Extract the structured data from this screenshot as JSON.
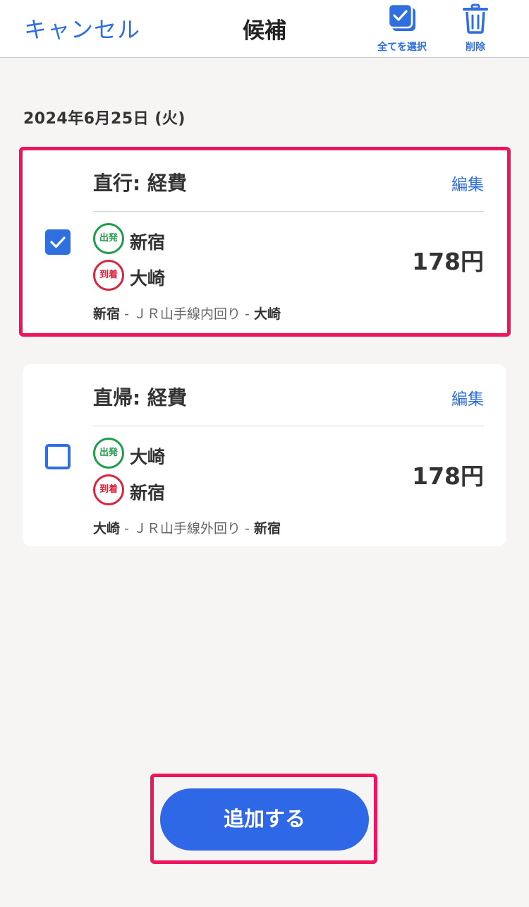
{
  "header": {
    "cancel_label": "キャンセル",
    "title": "候補",
    "select_all_label": "全てを選択",
    "delete_label": "削除"
  },
  "date_label": "2024年6月25日 (火)",
  "candidates": [
    {
      "title": "直行: 経費",
      "edit_label": "編集",
      "checked": true,
      "departure_badge": "出発",
      "arrival_badge": "到着",
      "departure": "新宿",
      "arrival": "大崎",
      "price": "178円",
      "route_from": "新宿",
      "route_line": "ＪＲ山手線内回り",
      "route_to": "大崎"
    },
    {
      "title": "直帰: 経費",
      "edit_label": "編集",
      "checked": false,
      "departure_badge": "出発",
      "arrival_badge": "到着",
      "departure": "大崎",
      "arrival": "新宿",
      "price": "178円",
      "route_from": "大崎",
      "route_line": "ＪＲ山手線外回り",
      "route_to": "新宿"
    }
  ],
  "add_button_label": "追加する",
  "colors": {
    "accent": "#2f6fe0",
    "highlight": "#f0145f",
    "departure": "#1f9d4a",
    "arrival": "#d7263d"
  }
}
